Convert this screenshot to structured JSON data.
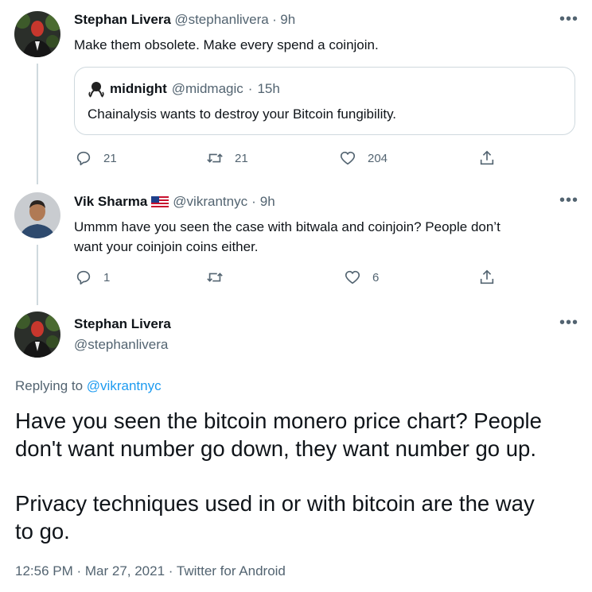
{
  "tweet1": {
    "name": "Stephan Livera",
    "handle": "@stephanlivera",
    "sep": "·",
    "time": "9h",
    "text": "Make them obsolete. Make every spend a coinjoin.",
    "quote": {
      "name": "midnight",
      "handle": "@midmagic",
      "sep": "·",
      "time": "15h",
      "text": "Chainalysis wants to destroy your Bitcoin fungibility."
    },
    "replies": "21",
    "retweets": "21",
    "likes": "204"
  },
  "tweet2": {
    "name": "Vik Sharma",
    "flag_icon": "us-flag-icon",
    "handle": "@vikrantnyc",
    "sep": "·",
    "time": "9h",
    "text_line1": "Ummm have you seen the case with bitwala and coinjoin?  People don’t",
    "text_line2": "want your coinjoin coins either.",
    "replies": "1",
    "retweets": "",
    "likes": "6"
  },
  "tweet3": {
    "name": "Stephan Livera",
    "handle": "@stephanlivera",
    "replying_prefix": "Replying to",
    "replying_to": "@vikrantnyc",
    "para1_line1": "Have you seen the bitcoin monero price chart? People",
    "para1_line2": "don't want number go down, they want number go up.",
    "para2_line1": "Privacy techniques used in or with bitcoin are the way",
    "para2_line2": "to go.",
    "timestamp": "12:56 PM · Mar 27, 2021",
    "sep": "·",
    "source": "Twitter for Android"
  },
  "icons": {
    "more": "more-icon",
    "reply": "reply-icon",
    "retweet": "retweet-icon",
    "like": "like-icon",
    "share": "share-icon"
  },
  "colors": {
    "accent": "#1d9bf0",
    "secondary_text": "#536471",
    "border": "#cfd9de"
  }
}
